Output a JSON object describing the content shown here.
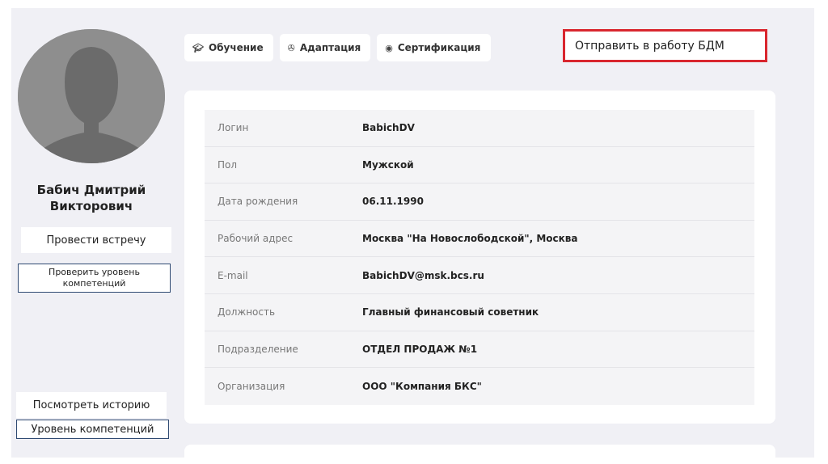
{
  "profile": {
    "name_line1": "Бабич Дмитрий",
    "name_line2": "Викторович",
    "buttons": {
      "meet": "Провести встречу",
      "check_level": "Проверить уровень компетенций",
      "history": "Посмотреть историю",
      "level": "Уровень компетенций"
    }
  },
  "tabs": [
    {
      "label": "Обучение",
      "icon": "graduation-cap-icon"
    },
    {
      "label": "Адаптация",
      "icon": "adaptation-icon"
    },
    {
      "label": "Сертификация",
      "icon": "certificate-icon"
    }
  ],
  "header": {
    "send_button": "Отправить в работу БДМ"
  },
  "info": [
    {
      "label": "Логин",
      "value": "BabichDV"
    },
    {
      "label": "Пол",
      "value": "Мужской"
    },
    {
      "label": "Дата рождения",
      "value": "06.11.1990"
    },
    {
      "label": "Рабочий адрес",
      "value": "Москва \"На Новослободской\", Москва"
    },
    {
      "label": "E-mail",
      "value": "BabichDV@msk.bcs.ru"
    },
    {
      "label": "Должность",
      "value": "Главный финансовый советник"
    },
    {
      "label": "Подразделение",
      "value": "ОТДЕЛ ПРОДАЖ №1"
    },
    {
      "label": "Организация",
      "value": "ООО \"Компания БКС\""
    }
  ],
  "colors": {
    "background": "#f0f0f5",
    "highlight_border": "#d9262e",
    "outline_border": "#2f4a72"
  }
}
